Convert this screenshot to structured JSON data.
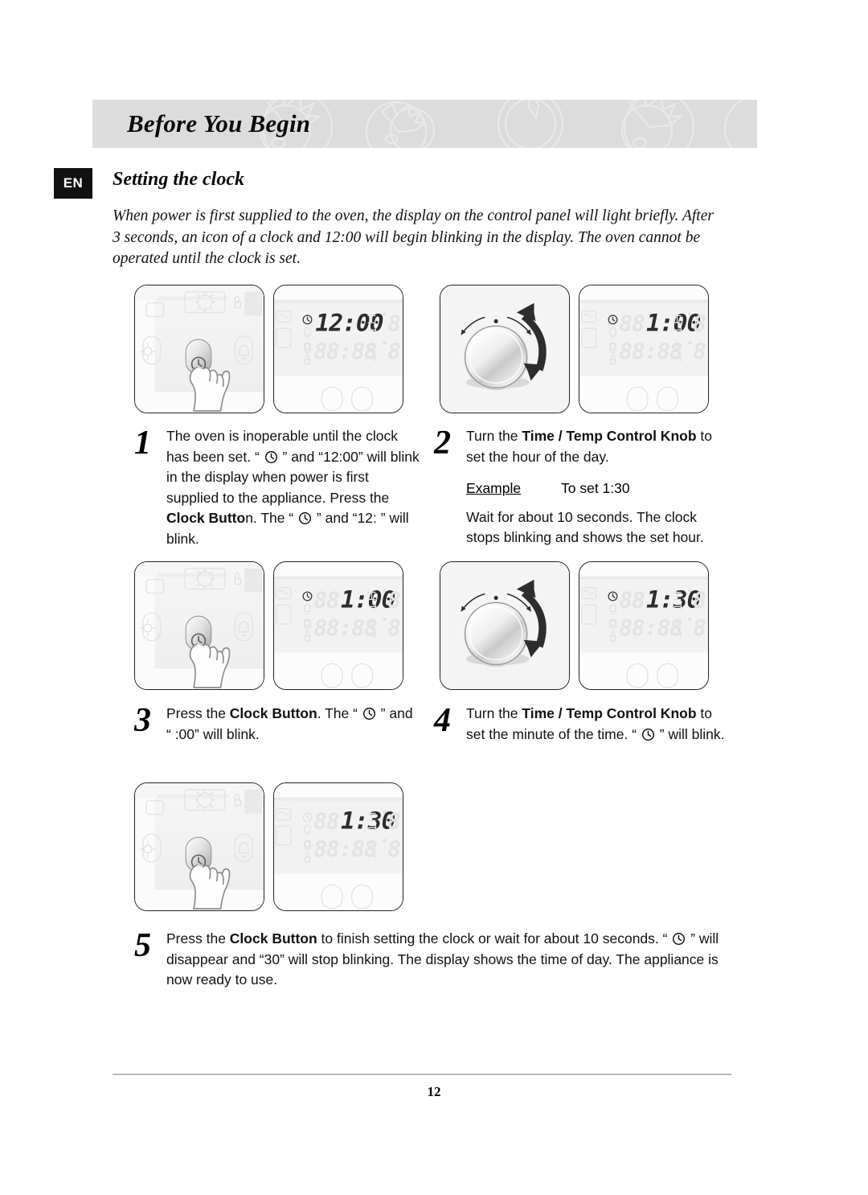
{
  "header": {
    "title": "Before You Begin",
    "band_color": "#dcdcdc",
    "watermark": "tomato-outline-pattern"
  },
  "language_badge": "EN",
  "section": {
    "title": "Setting the clock"
  },
  "intro": "When power is first supplied to the oven, the display on the control panel will light briefly. After 3 seconds, an icon of a clock and 12:00 will begin blinking in the display. The oven cannot be operated until the clock is set.",
  "steps": [
    {
      "number": "1",
      "parts": [
        {
          "text": "The oven is inoperable until the clock has been set. “ ",
          "bold": false
        },
        {
          "icon": "clock-icon"
        },
        {
          "text": " ” and “12:00” will blink in the display when power is first supplied to the appliance. Press the ",
          "bold": false
        },
        {
          "text": "Clock Butto",
          "bold": true
        },
        {
          "text": "n. The “ ",
          "bold": false
        },
        {
          "icon": "clock-icon"
        },
        {
          "text": " ” and “12: ” will blink.",
          "bold": false
        }
      ]
    },
    {
      "number": "2",
      "parts": [
        {
          "text": "Turn the ",
          "bold": false
        },
        {
          "text": "Time / Temp Control Knob",
          "bold": true
        },
        {
          "text": " to set the hour of the day.",
          "bold": false
        }
      ],
      "example_label": "Example",
      "example_value": "To set 1:30",
      "note": "Wait for about 10 seconds. The clock stops blinking and shows the set hour."
    },
    {
      "number": "3",
      "parts": [
        {
          "text": "Press the ",
          "bold": false
        },
        {
          "text": "Clock Button",
          "bold": true
        },
        {
          "text": ". The “ ",
          "bold": false
        },
        {
          "icon": "clock-icon"
        },
        {
          "text": " ” and “ :00” will blink.",
          "bold": false
        }
      ]
    },
    {
      "number": "4",
      "parts": [
        {
          "text": "Turn the ",
          "bold": false
        },
        {
          "text": "Time / Temp Control Knob",
          "bold": true
        },
        {
          "text": " to set the minute of the time. “ ",
          "bold": false
        },
        {
          "icon": "clock-icon"
        },
        {
          "text": " ” will blink.",
          "bold": false
        }
      ]
    },
    {
      "number": "5",
      "parts": [
        {
          "text": "Press the ",
          "bold": false
        },
        {
          "text": "Clock Button",
          "bold": true
        },
        {
          "text": " to finish setting the clock or wait for about 10 seconds. “ ",
          "bold": false
        },
        {
          "icon": "clock-icon"
        },
        {
          "text": " ” will disappear and “30” will stop blinking. The display shows the time of day. The appliance is now ready to use.",
          "bold": false
        }
      ]
    }
  ],
  "illustrations": {
    "row1": {
      "panel_a": {
        "type": "control-panel-press",
        "button": "clock-button",
        "hand": "finger-press"
      },
      "panel_b": {
        "type": "lcd-display",
        "active_value": "12:00",
        "ghost_value": "88:88",
        "clock_icon": true
      }
    },
    "row1_right": {
      "panel_c": {
        "type": "rotary-knob",
        "arrow": "bidirectional-curved-arrow"
      },
      "panel_d": {
        "type": "lcd-display",
        "active_value": "1:00",
        "ghost_value": "88:88",
        "ghost_prefix": "88",
        "clock_icon": true
      }
    },
    "row2": {
      "panel_a": {
        "type": "control-panel-press",
        "button": "clock-button",
        "hand": "finger-press"
      },
      "panel_b": {
        "type": "lcd-display",
        "active_value": "1:00",
        "ghost_value": "88:88",
        "ghost_prefix": "88",
        "clock_icon": true
      }
    },
    "row2_right": {
      "panel_c": {
        "type": "rotary-knob",
        "arrow": "bidirectional-curved-arrow"
      },
      "panel_d": {
        "type": "lcd-display",
        "active_value": "1:30",
        "ghost_value": "88:88",
        "ghost_prefix": "88",
        "clock_icon": true
      }
    },
    "row3": {
      "panel_a": {
        "type": "control-panel-press",
        "button": "clock-button",
        "hand": "finger-press"
      },
      "panel_b": {
        "type": "lcd-display",
        "active_value": "1:30",
        "ghost_value": "88:88",
        "ghost_prefix": "88",
        "clock_icon": true
      }
    }
  },
  "footer": {
    "page_number": "12"
  }
}
